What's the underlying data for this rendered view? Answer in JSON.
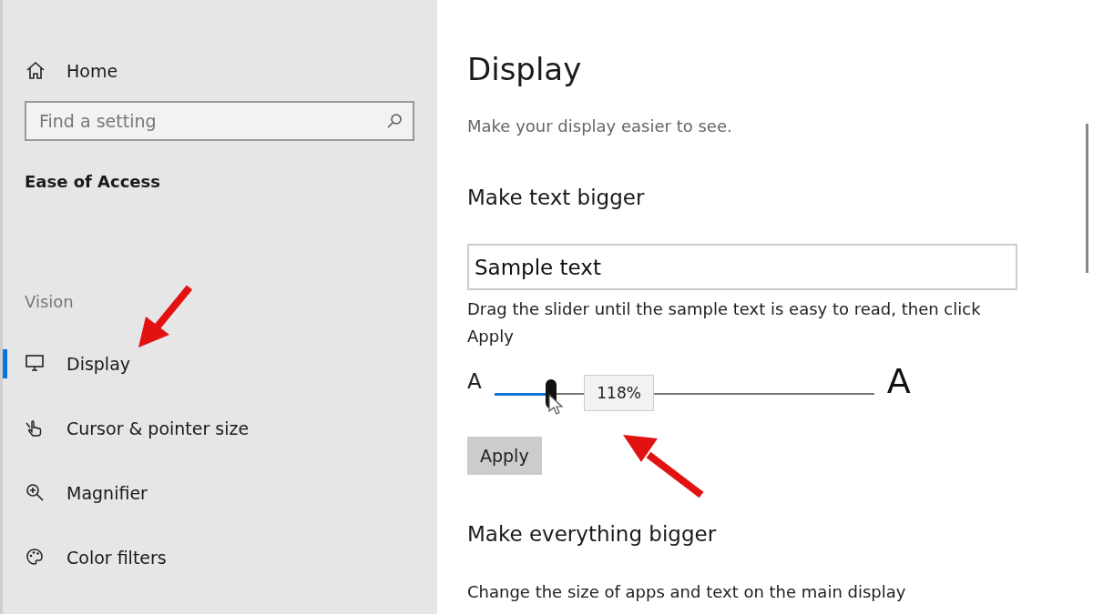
{
  "sidebar": {
    "home": "Home",
    "search": {
      "placeholder": "Find a setting"
    },
    "section_title": "Ease of Access",
    "group_label": "Vision",
    "items": [
      {
        "label": "Display",
        "selected": true
      },
      {
        "label": "Cursor & pointer size",
        "selected": false
      },
      {
        "label": "Magnifier",
        "selected": false
      },
      {
        "label": "Color filters",
        "selected": false
      }
    ]
  },
  "main": {
    "title": "Display",
    "subtitle": "Make your display easier to see.",
    "text_section": {
      "heading": "Make text bigger",
      "sample": "Sample text",
      "instructions": "Drag the slider until the sample text is easy to read, then click Apply",
      "small_label": "A",
      "large_label": "A",
      "slider": {
        "level": 0.15,
        "tooltip": "118%"
      },
      "apply_button": "Apply"
    },
    "everything_section": {
      "heading": "Make everything bigger",
      "description": "Change the size of apps and text on the main display"
    }
  }
}
